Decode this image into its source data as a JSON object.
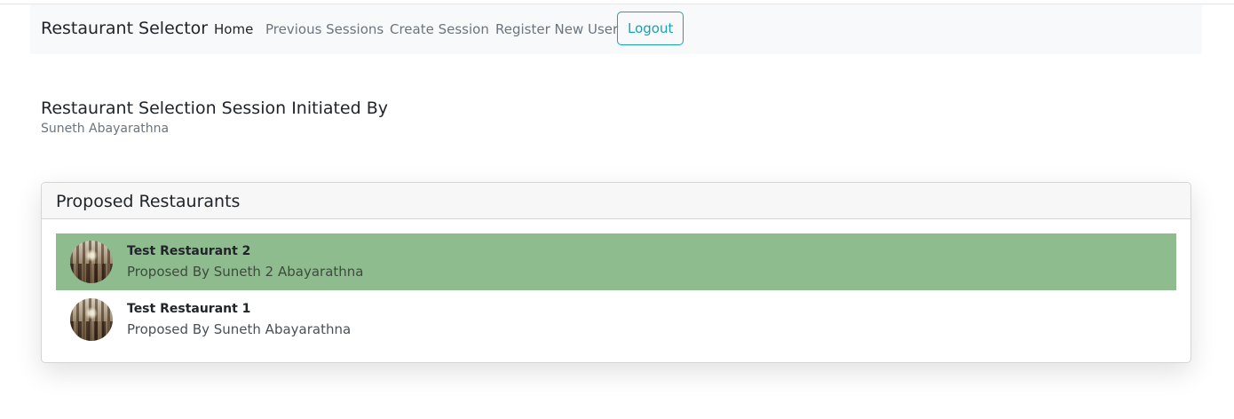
{
  "navbar": {
    "brand": "Restaurant Selector",
    "links": [
      {
        "label": "Home",
        "active": true
      },
      {
        "label": "Previous Sessions",
        "active": false
      },
      {
        "label": "Create Session",
        "active": false
      },
      {
        "label": "Register New User",
        "active": false
      }
    ],
    "logout_label": "Logout"
  },
  "session": {
    "heading": "Restaurant Selection Session Initiated By",
    "initiator": "Suneth Abayarathna"
  },
  "proposals": {
    "title": "Proposed Restaurants",
    "items": [
      {
        "name": "Test Restaurant 2",
        "proposed_by": "Proposed By Suneth 2 Abayarathna",
        "highlighted": true
      },
      {
        "name": "Test Restaurant 1",
        "proposed_by": "Proposed By Suneth Abayarathna",
        "highlighted": false
      }
    ]
  },
  "colors": {
    "navbar_bg": "#f8f9fa",
    "logout_accent": "#17a2b8",
    "highlight_row": "#8fbc8f"
  },
  "icons": {
    "restaurant_avatar": "restaurant-photo-avatar"
  }
}
